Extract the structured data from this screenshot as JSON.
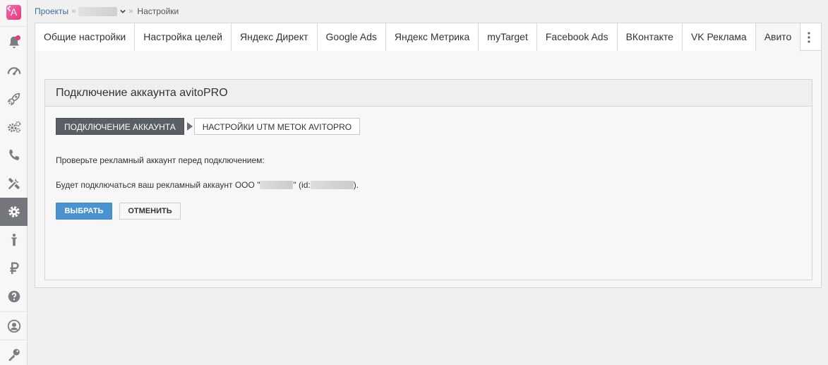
{
  "sidebar": {
    "logo_letter": "A",
    "items": [
      {
        "icon": "bell-icon",
        "badge": true
      },
      {
        "icon": "speedometer-icon"
      },
      {
        "icon": "rocket-icon"
      },
      {
        "icon": "gears-icon"
      },
      {
        "icon": "phone-icon"
      },
      {
        "icon": "tools-icon"
      },
      {
        "icon": "settings-gear-icon",
        "active": true
      },
      {
        "icon": "person-icon"
      },
      {
        "icon": "ruble-icon"
      },
      {
        "icon": "help-icon"
      },
      {
        "icon": "user-circle-icon"
      },
      {
        "icon": "key-icon"
      }
    ]
  },
  "breadcrumb": {
    "projects_label": "Проекты",
    "current_label": "Настройки"
  },
  "tabs": [
    {
      "label": "Общие настройки"
    },
    {
      "label": "Настройка целей"
    },
    {
      "label": "Яндекс Директ"
    },
    {
      "label": "Google Ads"
    },
    {
      "label": "Яндекс Метрика"
    },
    {
      "label": "myTarget"
    },
    {
      "label": "Facebook Ads"
    },
    {
      "label": "ВКонтакте"
    },
    {
      "label": "VK Реклама"
    },
    {
      "label": "Авито",
      "active": true
    }
  ],
  "card": {
    "title": "Подключение аккаунта avitoPRO",
    "steps": {
      "step1": "Подключение аккаунта",
      "step2": "Настройки UTM меток avitoPRO"
    },
    "check_text": "Проверьте рекламный аккаунт перед подключением:",
    "connect_text_prefix": "Будет подключаться ваш рекламный аккаунт ООО \"",
    "connect_text_mid": "\" (id: ",
    "connect_text_suffix": ").",
    "select_button": "Выбрать",
    "cancel_button": "Отменить"
  },
  "colors": {
    "accent_pink": "#e8387a",
    "primary_blue": "#4a93d3",
    "active_sidebar": "#74777c",
    "step_active": "#5a5f66"
  }
}
